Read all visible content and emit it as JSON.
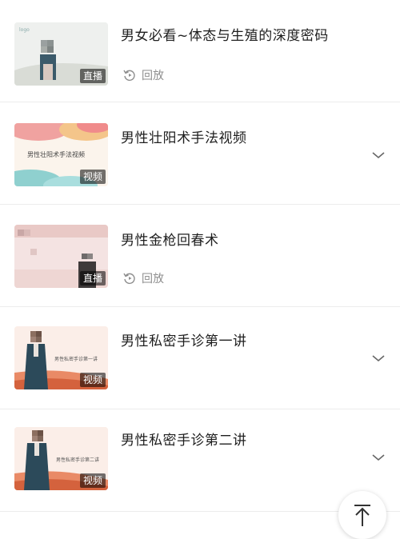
{
  "items": [
    {
      "title": "男女必看~体态与生殖的深度密码",
      "badge": "直播",
      "replay_label": "回放",
      "type": "live"
    },
    {
      "title": "男性壮阳术手法视频",
      "badge": "视频",
      "type": "video",
      "thumb_caption": "男性壮阳术手法视频"
    },
    {
      "title": "男性金枪回春术",
      "badge": "直播",
      "replay_label": "回放",
      "type": "live"
    },
    {
      "title": "男性私密手诊第一讲",
      "badge": "视频",
      "type": "video",
      "thumb_caption": "男性私密手诊第一讲"
    },
    {
      "title": "男性私密手诊第二讲",
      "badge": "视频",
      "type": "video",
      "thumb_caption": "男性私密手诊第二讲"
    }
  ],
  "icons": {
    "replay": "replay-icon",
    "expand": "chevron-down-icon",
    "scroll_top": "arrow-up-to-top-icon"
  },
  "colors": {
    "title": "#1e1e1e",
    "muted": "#8e8e8e",
    "divider": "#ececec"
  }
}
